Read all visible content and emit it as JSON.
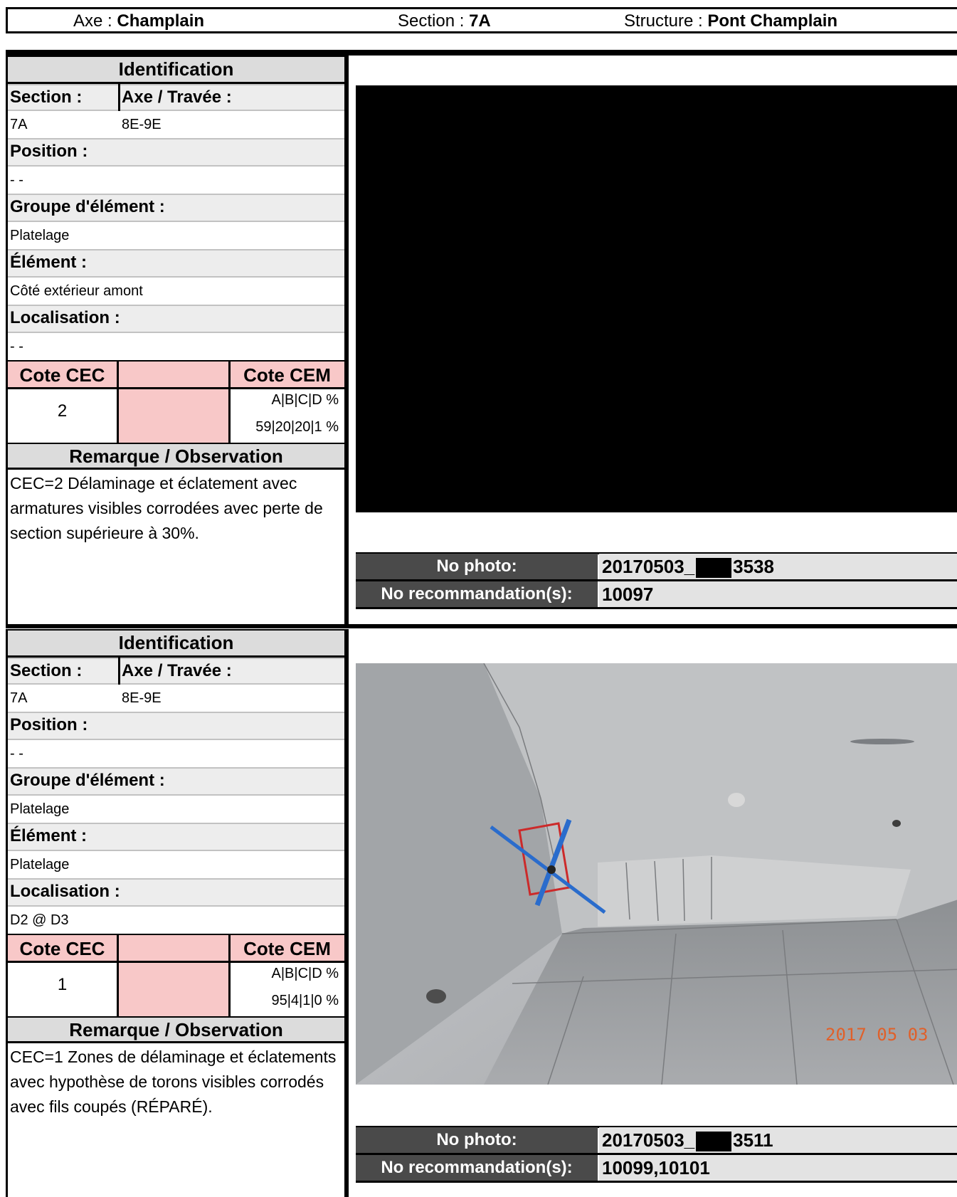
{
  "header": {
    "axe_label": "Axe : ",
    "axe_value": "Champlain",
    "section_label": "Section : ",
    "section_value": "7A",
    "structure_label": "Structure : ",
    "structure_value": "Pont Champlain"
  },
  "records": [
    {
      "identification_title": "Identification",
      "section_label": "Section :",
      "axe_travee_label": "Axe / Travée :",
      "section_value": "7A",
      "axe_travee_value": "8E-9E",
      "position_label": "Position :",
      "position_value": "- -",
      "groupe_label": "Groupe d'élément :",
      "groupe_value": "Platelage",
      "element_label": "Élément :",
      "element_value": "Côté extérieur amont",
      "localisation_label": "Localisation :",
      "localisation_value": "- -",
      "cote_cec_label": "Cote CEC",
      "cote_cec_value": "2",
      "cote_cem_label": "Cote CEM",
      "cote_cem_header": "A|B|C|D %",
      "cote_cem_values": "59|20|20|1 %",
      "remark_title": "Remarque / Observation",
      "remark_lines": [
        "CEC=2 Délaminage et éclatement avec",
        "armatures visibles corrodées avec perte de",
        "section supérieure à 30%."
      ],
      "photo_label": "No photo:",
      "photo_prefix": "20170503_",
      "photo_suffix": "3538",
      "recommandation_label": "No recommandation(s):",
      "recommandation_value": "10097"
    },
    {
      "identification_title": "Identification",
      "section_label": "Section :",
      "axe_travee_label": "Axe / Travée :",
      "section_value": "7A",
      "axe_travee_value": "8E-9E",
      "position_label": "Position :",
      "position_value": "- -",
      "groupe_label": "Groupe d'élément :",
      "groupe_value": "Platelage",
      "element_label": "Élément :",
      "element_value": "Platelage",
      "localisation_label": "Localisation :",
      "localisation_value": "D2 @ D3",
      "cote_cec_label": "Cote CEC",
      "cote_cec_value": "1",
      "cote_cem_label": "Cote CEM",
      "cote_cem_header": "A|B|C|D %",
      "cote_cem_values": "95|4|1|0 %",
      "remark_title": "Remarque / Observation",
      "remark_lines": [
        "CEC=1 Zones de délaminage et éclatements",
        "avec hypothèse de torons visibles corrodés",
        "avec fils coupés (RÉPARÉ)."
      ],
      "photo_label": "No photo:",
      "photo_prefix": "20170503_",
      "photo_suffix": "3511",
      "recommandation_label": "No recommandation(s):",
      "recommandation_value": "10099,10101",
      "photo_date_stamp": "2017 05 03"
    }
  ],
  "colors": {
    "label_bg": "#ededed",
    "pink_cells": "#f8c8c8",
    "meta_key_bg": "#4a4a4a",
    "meta_val_bg": "#e3e3e3",
    "date_stamp": "#e0602a"
  }
}
